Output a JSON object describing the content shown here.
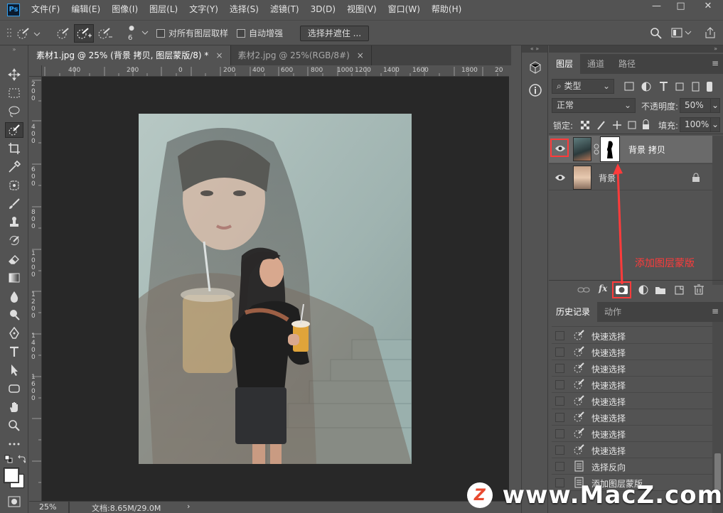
{
  "app": {
    "logo_text": "Ps",
    "accent": "#2fa0f2"
  },
  "menu": [
    "文件(F)",
    "编辑(E)",
    "图像(I)",
    "图层(L)",
    "文字(Y)",
    "选择(S)",
    "滤镜(T)",
    "3D(D)",
    "视图(V)",
    "窗口(W)",
    "帮助(H)"
  ],
  "window_controls": {
    "minimize": "—",
    "restore": "□",
    "close": "✕"
  },
  "options": {
    "brush_size": "6",
    "sample_all_layers": "对所有图层取样",
    "auto_enhance": "自动增强",
    "select_and_mask": "选择并遮住 ..."
  },
  "tabs": [
    {
      "label": "素材1.jpg @ 25% (背景 拷贝, 图层蒙版/8) *",
      "close": "×"
    },
    {
      "label": "素材2.jpg @ 25%(RGB/8#)",
      "close": "×"
    }
  ],
  "ruler": {
    "h": [
      "400",
      "200",
      "0",
      "200",
      "400",
      "600",
      "800",
      "1000",
      "1200",
      "1400",
      "1600",
      "1800",
      "20"
    ],
    "v": [
      "2",
      "0",
      "0",
      "4",
      "0",
      "0",
      "6",
      "0",
      "0",
      "8",
      "0",
      "0",
      "1",
      "0",
      "0",
      "0",
      "1",
      "2",
      "0",
      "0",
      "1",
      "4",
      "0",
      "0",
      "1",
      "6",
      "0",
      "0",
      "1",
      "8"
    ]
  },
  "status": {
    "zoom": "25%",
    "doc": "文档:8.65M/29.0M",
    "arrow": "›"
  },
  "layers_panel": {
    "tabs": [
      "图层",
      "通道",
      "路径"
    ],
    "filter": "类型",
    "blend_mode": "正常",
    "opacity_label": "不透明度:",
    "opacity_value": "50%",
    "lock_label": "锁定:",
    "fill_label": "填充:",
    "fill_value": "100%",
    "layers": [
      {
        "name": "背景 拷贝",
        "visible": true,
        "has_mask": true
      },
      {
        "name": "背景",
        "visible": true,
        "locked": true
      }
    ]
  },
  "annotation": {
    "text": "添加图层蒙版",
    "color": "#ff3b3b"
  },
  "history_panel": {
    "tabs": [
      "历史记录",
      "动作"
    ],
    "items": [
      {
        "label": "快速选择",
        "icon": "quick-select"
      },
      {
        "label": "快速选择",
        "icon": "quick-select"
      },
      {
        "label": "快速选择",
        "icon": "quick-select"
      },
      {
        "label": "快速选择",
        "icon": "quick-select"
      },
      {
        "label": "快速选择",
        "icon": "quick-select"
      },
      {
        "label": "快速选择",
        "icon": "quick-select"
      },
      {
        "label": "快速选择",
        "icon": "quick-select"
      },
      {
        "label": "快速选择",
        "icon": "quick-select"
      },
      {
        "label": "选择反向",
        "icon": "document"
      },
      {
        "label": "添加图层蒙版",
        "icon": "document"
      }
    ]
  },
  "watermark": {
    "text": "www.MacZ.com",
    "logo_letter": "Z"
  }
}
